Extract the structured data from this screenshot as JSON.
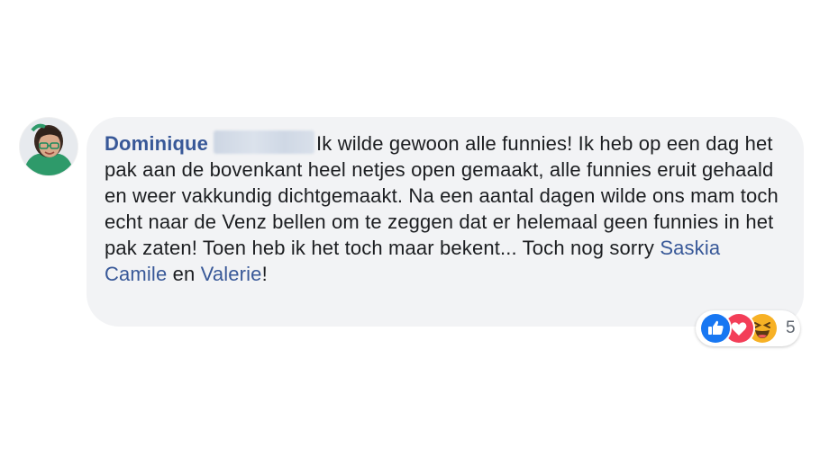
{
  "comment": {
    "author": "Dominique",
    "text_parts": [
      {
        "text": "Ik wilde gewoon alle funnies! Ik heb op een dag het pak aan de bovenkant heel netjes open gemaakt, alle funnies eruit gehaald en weer vakkundig dichtgemaakt. Na een aantal dagen wilde ons mam toch echt naar de Venz bellen om te zeggen dat er helemaal geen funnies in het pak zaten! Toen heb ik het toch maar bekent... Toch nog sorry ",
        "mention": false
      },
      {
        "text": "Saskia Camile",
        "mention": true
      },
      {
        "text": " en ",
        "mention": false
      },
      {
        "text": "Valerie",
        "mention": true
      },
      {
        "text": "!",
        "mention": false
      }
    ]
  },
  "reactions": {
    "icons": [
      "like-icon",
      "love-icon",
      "haha-icon"
    ],
    "count": "5"
  },
  "colors": {
    "author": "#385898",
    "mention": "#385898",
    "bubble": "#f2f3f5",
    "like": "#1877f2",
    "love": "#f33e58",
    "haha": "#f7b125"
  }
}
